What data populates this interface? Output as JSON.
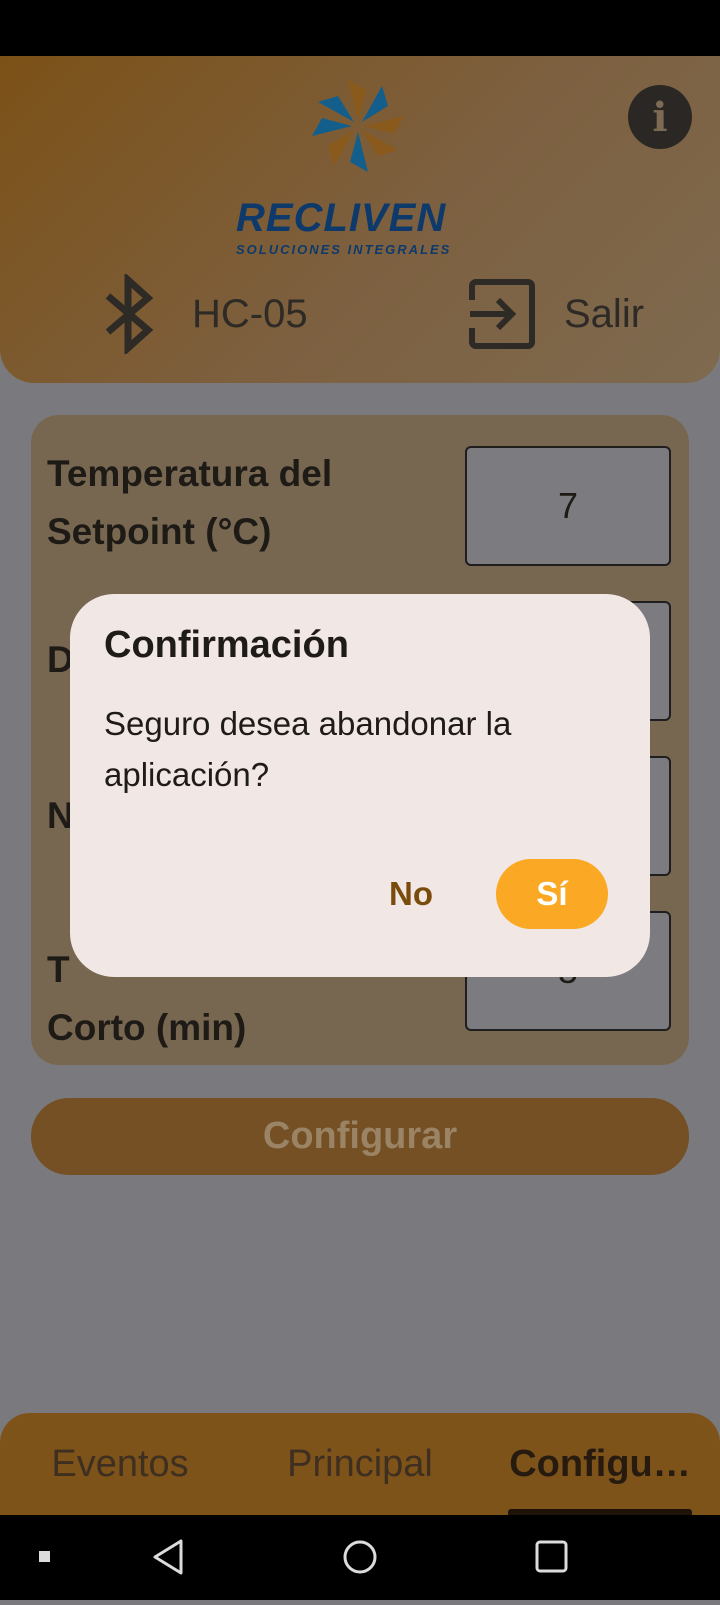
{
  "header": {
    "brand": "RECLIVEN",
    "tagline": "SOLUCIONES INTEGRALES",
    "info_icon": "info-icon",
    "bluetooth_label": "HC-05",
    "exit_label": "Salir"
  },
  "form": {
    "fields": [
      {
        "label": "Temperatura del Setpoint (°C)",
        "value": "7"
      },
      {
        "label": "D",
        "value": ""
      },
      {
        "label": "N",
        "value": ""
      },
      {
        "label_visible_top": "T",
        "label_visible_bottom": "Corto (min)",
        "value": "5"
      }
    ],
    "configure_label": "Configurar"
  },
  "tabs": {
    "items": [
      "Eventos",
      "Principal",
      "Configu…"
    ],
    "active_index": 2
  },
  "dialog": {
    "title": "Confirmación",
    "message": "Seguro desea abandonar la aplicación?",
    "no_label": "No",
    "yes_label": "Sí"
  },
  "colors": {
    "accent": "#fba924",
    "brand_blue": "#0d3a6a",
    "header_brown": "#7c5117"
  }
}
